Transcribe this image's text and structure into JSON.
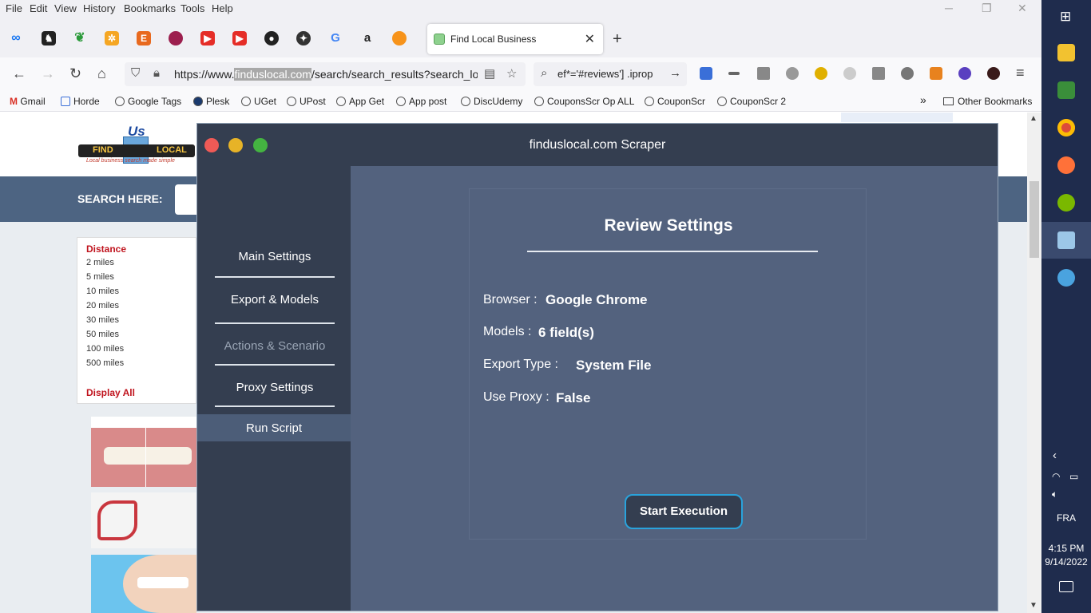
{
  "browser": {
    "menu": [
      "File",
      "Edit",
      "View",
      "History",
      "Bookmarks",
      "Tools",
      "Help"
    ],
    "tab_title": "Find Local Business",
    "url_prefix": "https://www.",
    "url_highlight": "finduslocal.com",
    "url_rest": "/search/search_results?search_loca",
    "search_text": "ef*='#reviews'] .iprop",
    "bookmarks": [
      "Gmail",
      "Horde",
      "Google Tags",
      "Plesk",
      "UGet",
      "UPost",
      "App Get",
      "App post",
      "DiscUdemy",
      "CouponsScr Op ALL",
      "CouponScr",
      "CouponScr 2"
    ],
    "other_bookmarks": "Other Bookmarks"
  },
  "site": {
    "logo_us": "Us",
    "logo_find": "FIND",
    "logo_local": "LOCAL",
    "logo_tagline": "Local business     search made simple",
    "search_label": "SEARCH HERE:",
    "filter_title": "Distance",
    "filter_options": [
      "2 miles",
      "5 miles",
      "10 miles",
      "20 miles",
      "30 miles",
      "50 miles",
      "100 miles",
      "500 miles"
    ],
    "filter_all": "Display All"
  },
  "app": {
    "title": "finduslocal.com Scraper",
    "colors": {
      "close": "#f05a56",
      "minimize": "#e7b327",
      "maximize": "#44b441",
      "accent_border": "#29a3dc"
    },
    "nav": {
      "main_settings": "Main Settings",
      "export_models": "Export & Models",
      "actions_scenario": "Actions & Scenario",
      "proxy_settings": "Proxy Settings",
      "run_script": "Run Script"
    },
    "panel": {
      "title": "Review Settings",
      "browser_label": "Browser :",
      "browser_value": "Google Chrome",
      "models_label": "Models :",
      "models_value": "6 field(s)",
      "export_label": "Export Type :",
      "export_value": "System File",
      "proxy_label": "Use Proxy :",
      "proxy_value": "False",
      "start_button": "Start Execution"
    }
  },
  "taskbar": {
    "language": "FRA",
    "time": "4:15 PM",
    "date": "9/14/2022"
  }
}
